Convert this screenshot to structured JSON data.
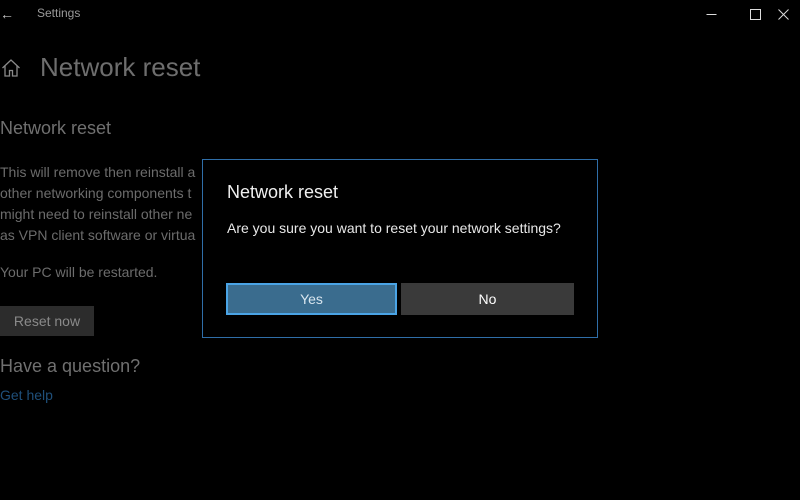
{
  "window": {
    "title": "Settings",
    "back_glyph": "←",
    "controls": [
      "minimize-icon",
      "maximize-icon",
      "close-icon"
    ]
  },
  "page": {
    "home_icon": "home-icon",
    "title": "Network reset",
    "section_heading": "Network reset",
    "description_lines": [
      "This will remove then reinstall a",
      "other networking components t",
      "might need to reinstall other ne",
      "as VPN client software or virtua"
    ],
    "restart_note": "Your PC will be restarted.",
    "reset_now_label": "Reset now",
    "question_heading": "Have a question?",
    "get_help_label": "Get help"
  },
  "dialog": {
    "title": "Network reset",
    "message": "Are you sure you want to reset your network settings?",
    "yes_label": "Yes",
    "no_label": "No"
  },
  "colors": {
    "background": "#000000",
    "dialog_border": "#2f6ea8",
    "yes_button": "#3a6c8e",
    "yes_button_focus": "#4aa4e6",
    "no_button": "#3a3a3a",
    "link": "#1f4f7a"
  }
}
